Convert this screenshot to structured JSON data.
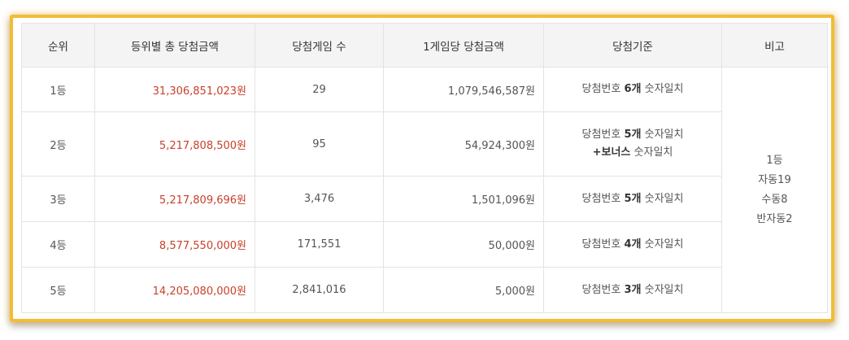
{
  "headers": [
    "순위",
    "등위별 총 당첨금액",
    "당첨게임 수",
    "1게임당 당첨금액",
    "당첨기준",
    "비고"
  ],
  "rows": [
    {
      "rank": "1등",
      "total": "31,306,851,023원",
      "games": "29",
      "per_game": "1,079,546,587원",
      "crit_pre": "당첨번호 ",
      "crit_bold": "6개",
      "crit_post": " 숫자일치",
      "crit2_bold": "",
      "crit2_post": ""
    },
    {
      "rank": "2등",
      "total": "5,217,808,500원",
      "games": "95",
      "per_game": "54,924,300원",
      "crit_pre": "당첨번호 ",
      "crit_bold": "5개",
      "crit_post": " 숫자일치",
      "crit2_bold": "+보너스",
      "crit2_post": " 숫자일치"
    },
    {
      "rank": "3등",
      "total": "5,217,809,696원",
      "games": "3,476",
      "per_game": "1,501,096원",
      "crit_pre": "당첨번호 ",
      "crit_bold": "5개",
      "crit_post": " 숫자일치",
      "crit2_bold": "",
      "crit2_post": ""
    },
    {
      "rank": "4등",
      "total": "8,577,550,000원",
      "games": "171,551",
      "per_game": "50,000원",
      "crit_pre": "당첨번호 ",
      "crit_bold": "4개",
      "crit_post": " 숫자일치",
      "crit2_bold": "",
      "crit2_post": ""
    },
    {
      "rank": "5등",
      "total": "14,205,080,000원",
      "games": "2,841,016",
      "per_game": "5,000원",
      "crit_pre": "당첨번호 ",
      "crit_bold": "3개",
      "crit_post": " 숫자일치",
      "crit2_bold": "",
      "crit2_post": ""
    }
  ],
  "note_lines": [
    "1등",
    "자동19",
    "수동8",
    "반자동2"
  ],
  "colors": {
    "frame": "#f2bd35",
    "amount": "#c8402a",
    "header_bg": "#f4f4f4"
  }
}
